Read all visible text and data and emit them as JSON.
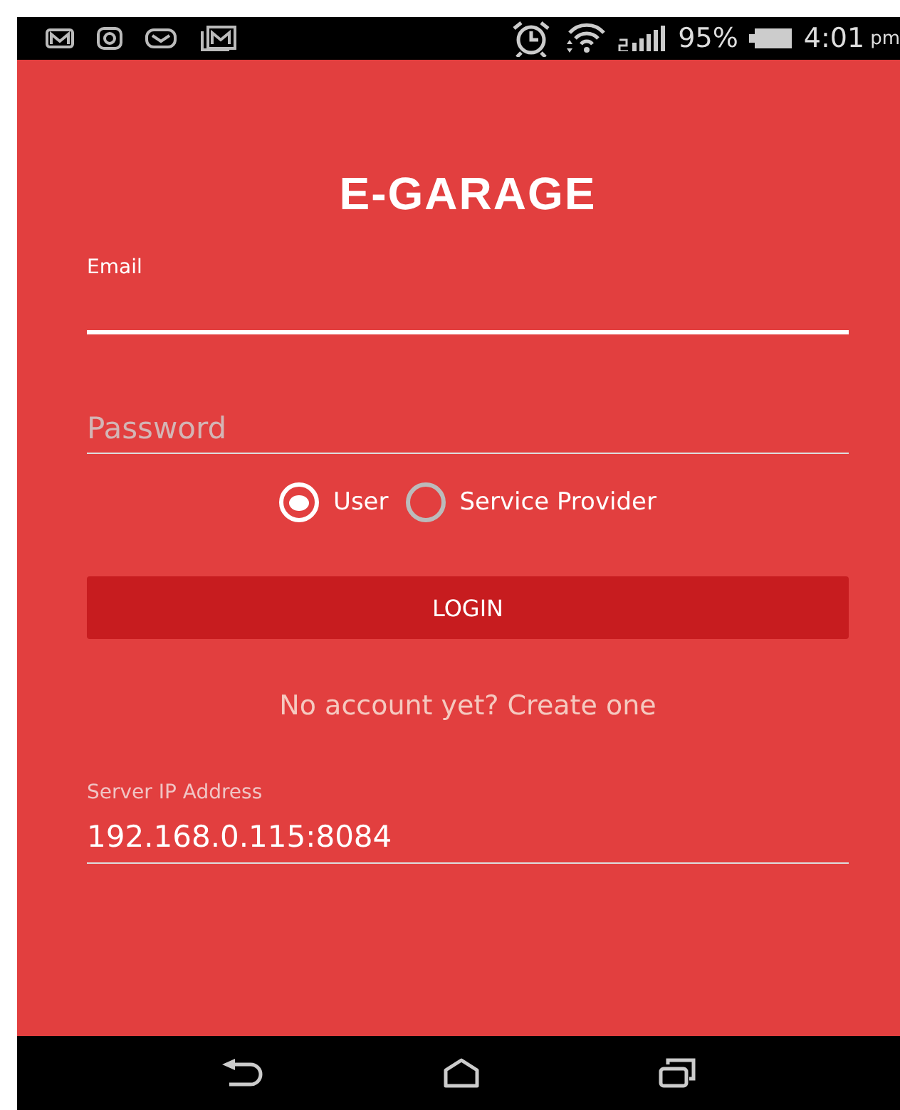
{
  "status_bar": {
    "battery": "95%",
    "time": "4:01",
    "time_suffix": "pm"
  },
  "title": "E-GARAGE",
  "email": {
    "label": "Email",
    "focused": true
  },
  "password": {
    "placeholder": "Password",
    "focused": false
  },
  "roles": [
    {
      "label": "User",
      "selected": true
    },
    {
      "label": "Service Provider",
      "selected": false
    }
  ],
  "login_button": "LOGIN",
  "signup_link": "No account yet? Create one",
  "server": {
    "label": "Server IP Address",
    "value": "192.168.0.115:8084"
  }
}
